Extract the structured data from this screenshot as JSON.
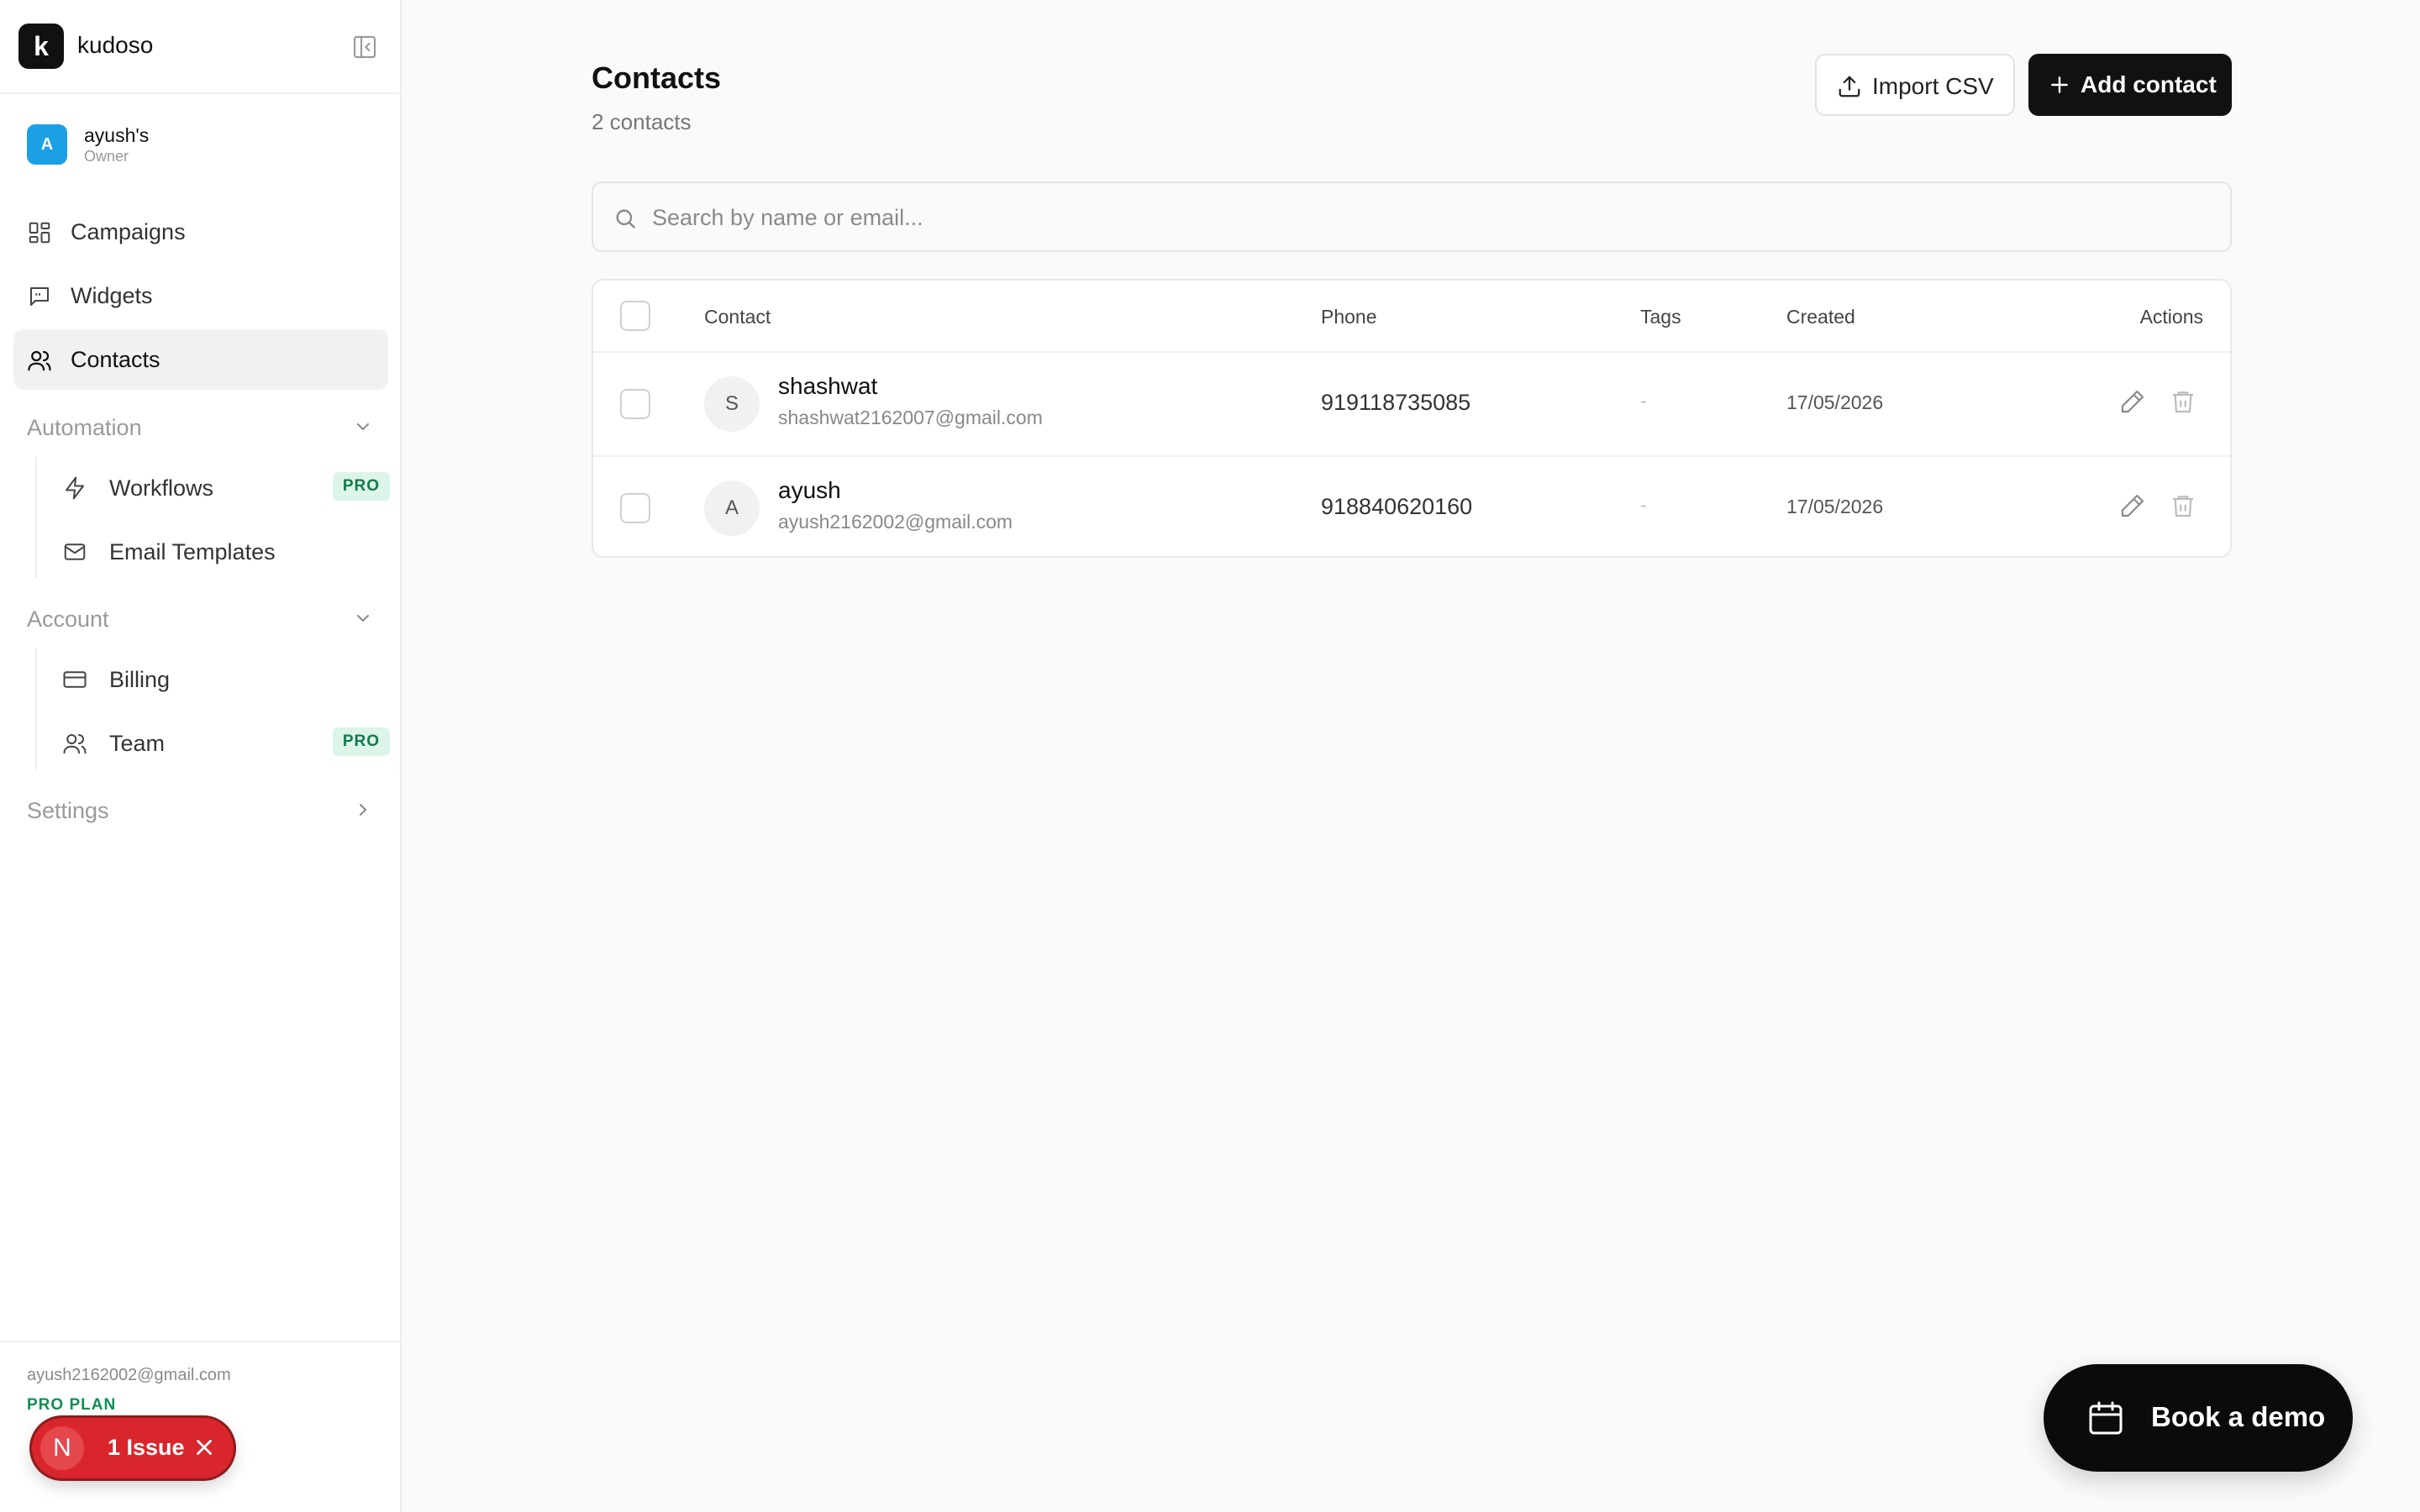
{
  "brand": {
    "logo_letter": "k",
    "name": "kudoso"
  },
  "workspace": {
    "avatar_letter": "A",
    "name": "ayush's",
    "role": "Owner"
  },
  "nav": {
    "campaigns": "Campaigns",
    "widgets": "Widgets",
    "contacts": "Contacts"
  },
  "automation": {
    "label": "Automation",
    "workflows": "Workflows",
    "workflows_badge": "PRO",
    "email_templates": "Email Templates"
  },
  "account": {
    "label": "Account",
    "billing": "Billing",
    "team": "Team",
    "team_badge": "PRO"
  },
  "settings": {
    "label": "Settings"
  },
  "footer": {
    "email": "ayush2162002@gmail.com",
    "plan": "PRO PLAN"
  },
  "issue": {
    "letter": "N",
    "text": "1 Issue"
  },
  "page": {
    "title": "Contacts",
    "subtitle": "2 contacts"
  },
  "actions": {
    "import": "Import CSV",
    "add": "Add contact"
  },
  "search": {
    "placeholder": "Search by name or email..."
  },
  "table": {
    "columns": {
      "contact": "Contact",
      "phone": "Phone",
      "tags": "Tags",
      "created": "Created",
      "actions": "Actions"
    },
    "rows": [
      {
        "initial": "S",
        "name": "shashwat",
        "email": "shashwat2162007@gmail.com",
        "phone": "919118735085",
        "tags": "-",
        "created": "17/05/2026"
      },
      {
        "initial": "A",
        "name": "ayush",
        "email": "ayush2162002@gmail.com",
        "phone": "918840620160",
        "tags": "-",
        "created": "17/05/2026"
      }
    ]
  },
  "demo": {
    "label": "Book a demo"
  },
  "colors": {
    "accent": "#111111",
    "pro_badge_bg": "#dcf5e8",
    "pro_badge_text": "#117a4a",
    "issue_red": "#d9262c",
    "workspace_avatar": "#1ba0e6"
  }
}
